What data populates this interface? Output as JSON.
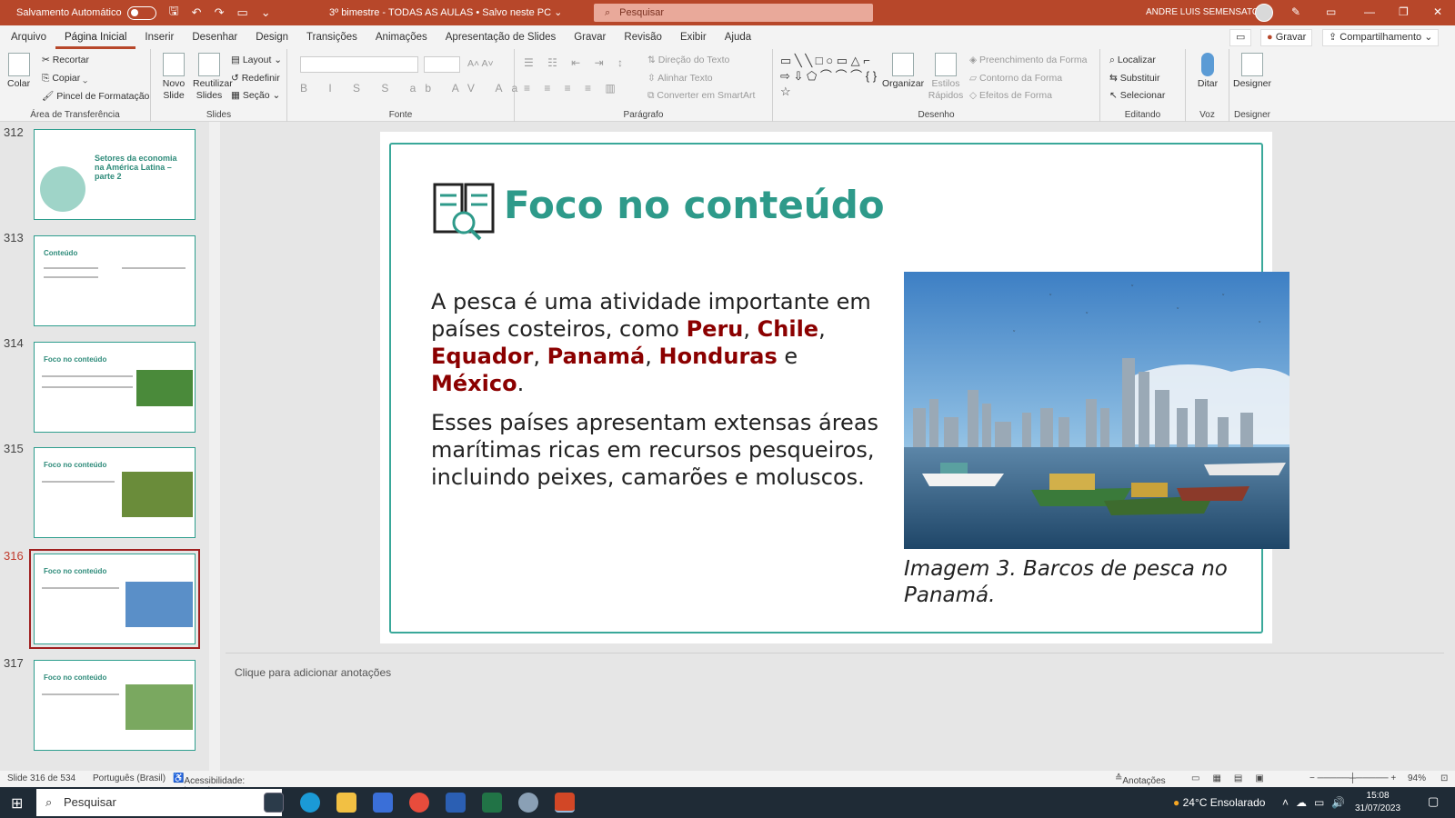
{
  "titlebar": {
    "autosave_label": "Salvamento Automático",
    "doc_title": "3º bimestre - TODAS AS AULAS  •  Salvo neste PC ⌄",
    "search_placeholder": "Pesquisar",
    "user_name": "ANDRE LUIS SEMENSATO"
  },
  "menu": {
    "tabs": [
      "Arquivo",
      "Página Inicial",
      "Inserir",
      "Desenhar",
      "Design",
      "Transições",
      "Animações",
      "Apresentação de Slides",
      "Gravar",
      "Revisão",
      "Exibir",
      "Ajuda"
    ],
    "record_button": "Gravar",
    "share_button": "Compartilhamento"
  },
  "ribbon": {
    "clipboard": {
      "paste": "Colar",
      "cut": "Recortar",
      "copy": "Copiar",
      "format_painter": "Pincel de Formatação",
      "label": "Área de Transferência"
    },
    "slides": {
      "new_slide": "Novo Slide",
      "reuse": "Reutilizar Slides",
      "layout": "Layout",
      "reset": "Redefinir",
      "section": "Seção",
      "label": "Slides"
    },
    "font": {
      "label": "Fonte"
    },
    "paragraph": {
      "text_direction": "Direção do Texto",
      "align_text": "Alinhar Texto",
      "smartart": "Converter em SmartArt",
      "label": "Parágrafo"
    },
    "drawing": {
      "arrange": "Organizar",
      "quick_styles": "Estilos Rápidos",
      "shape_fill": "Preenchimento da Forma",
      "shape_outline": "Contorno da Forma",
      "shape_effects": "Efeitos de Forma",
      "label": "Desenho"
    },
    "editing": {
      "find": "Localizar",
      "replace": "Substituir",
      "select": "Selecionar",
      "label": "Editando"
    },
    "voice": {
      "dictate": "Ditar",
      "label": "Voz"
    },
    "designer": {
      "designer": "Designer",
      "label": "Designer"
    }
  },
  "thumbnails": [
    {
      "number": "312",
      "title": "Setores da economia na América Latina – parte 2"
    },
    {
      "number": "313",
      "title": "Conteúdo"
    },
    {
      "number": "314",
      "title": "Foco no conteúdo"
    },
    {
      "number": "315",
      "title": "Foco no conteúdo"
    },
    {
      "number": "316",
      "title": "Foco no conteúdo"
    },
    {
      "number": "317",
      "title": "Foco no conteúdo"
    }
  ],
  "slide": {
    "title": "Foco no conteúdo",
    "p1_start": "A pesca é uma atividade importante em países costeiros, como ",
    "countries": [
      "Peru",
      "Chile",
      "Equador",
      "Panamá",
      "Honduras",
      "México"
    ],
    "p2": "Esses países apresentam extensas áreas marítimas ricas em recursos pesqueiros, incluindo peixes, camarões e moluscos.",
    "caption": "Imagem 3. Barcos de pesca no Panamá."
  },
  "notes_placeholder": "Clique para adicionar anotações",
  "status": {
    "slide_counter": "Slide 316 de 534",
    "language": "Português (Brasil)",
    "accessibility": "Acessibilidade: investigar",
    "notes": "Anotações",
    "zoom": "94%"
  },
  "taskbar": {
    "search": "Pesquisar",
    "weather": "24°C  Ensolarado",
    "time": "15:08",
    "date": "31/07/2023"
  },
  "colors": {
    "accent": "#b7472a",
    "teal": "#2e9a8a",
    "highlight": "#8b0000"
  }
}
